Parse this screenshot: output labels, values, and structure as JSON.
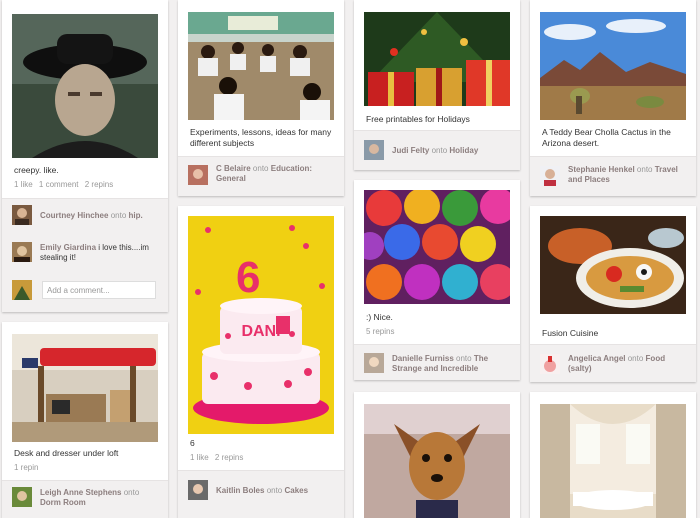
{
  "pins": {
    "creepy": {
      "description": "creepy. like.",
      "likes": "1 like",
      "comments": "1 comment",
      "repins": "2 repins",
      "attribution": {
        "name": "Courtney Hinchee",
        "onto": "onto",
        "board": "hip."
      },
      "comment": {
        "name": "Emily Giardina",
        "text": "i love this....im stealing it!"
      },
      "add_comment_placeholder": "Add a comment..."
    },
    "loft": {
      "description": "Desk and dresser under loft",
      "repins": "1 repin",
      "attribution": {
        "name": "Leigh Anne Stephens",
        "onto": "onto",
        "board": "Dorm Room"
      }
    },
    "classroom": {
      "description": "Experiments, lessons, ideas for many different subjects",
      "attribution": {
        "name": "C Belaire",
        "onto": "onto",
        "board": "Education: General"
      }
    },
    "cake": {
      "description": "6",
      "likes": "1 like",
      "repins": "2 repins",
      "cake_text": "DANI",
      "cake_number": "6",
      "attribution": {
        "name": "Kaitlin Boles",
        "onto": "onto",
        "board": "Cakes"
      }
    },
    "holidays": {
      "description": "Free printables for Holidays",
      "attribution": {
        "name": "Judi Felty",
        "onto": "onto",
        "board": "Holiday"
      }
    },
    "roses": {
      "description": ":) Nice.",
      "repins": "5 repins",
      "attribution": {
        "name": "Danielle Furniss",
        "onto": "onto",
        "board": "The Strange and Incredible"
      }
    },
    "cactus": {
      "description": "A Teddy Bear Cholla Cactus in the Arizona desert.",
      "attribution": {
        "name": "Stephanie Henkel",
        "onto": "onto",
        "board": "Travel and Places"
      }
    },
    "fusion": {
      "description": "Fusion Cuisine",
      "attribution": {
        "name": "Angelica Angel",
        "onto": "onto",
        "board": "Food (salty)"
      }
    }
  }
}
